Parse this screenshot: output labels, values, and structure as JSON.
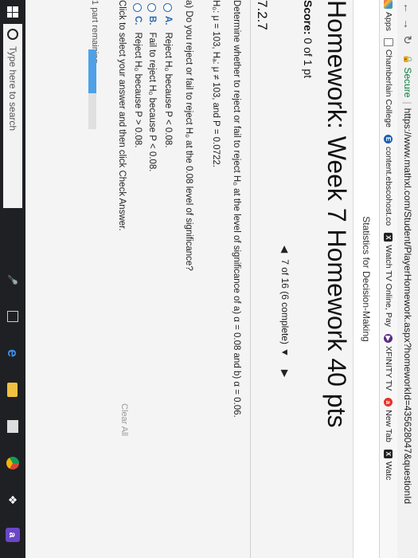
{
  "browser": {
    "secure_label": "Secure",
    "url": "https://www.mathxl.com/Student/PlayerHomework.aspx?homeworkId=435628047&questionId"
  },
  "bookmarks": [
    {
      "label": "Apps",
      "icon": "apps-icon"
    },
    {
      "label": "Chamberlain College",
      "icon": "document-icon"
    },
    {
      "label": "content.ebscohost.co",
      "icon": "ebsco-icon"
    },
    {
      "label": "Watch TV Online, Pay",
      "icon": "x-icon"
    },
    {
      "label": "XFINITY TV",
      "icon": "play-icon"
    },
    {
      "label": "New Tab",
      "icon": "a-icon"
    },
    {
      "label": "Watc",
      "icon": "x-icon"
    }
  ],
  "course_title": "Statistics for Decision-Making",
  "homework_title": "Homework: Week 7 Homework 40 pts",
  "score": {
    "label": "Score:",
    "value": "0 of 1 pt"
  },
  "progress": {
    "text": "7 of 16 (6 complete)"
  },
  "question": {
    "number": "7.2.7",
    "prompt": "Determine whether to reject or fail to reject H₀ at the level of significance of a) α = 0.08 and b) α = 0.06.",
    "hypotheses": "H₀: μ = 103, Hₐ: μ ≠ 103, and P = 0.0722.",
    "part_a": "a) Do you reject or fail to reject H₀ at the 0.08 level of significance?",
    "options": [
      {
        "letter": "A.",
        "text": "Reject H₀ because P < 0.08."
      },
      {
        "letter": "B.",
        "text": "Fail to reject H₀ because P < 0.08."
      },
      {
        "letter": "C.",
        "text": "Reject H₀ because P > 0.08."
      }
    ],
    "instruction": "Click to select your answer and then click Check Answer.",
    "clear_all": "Clear All"
  },
  "remaining": {
    "count": "1",
    "label": "part remaining",
    "fraction": 0.55
  },
  "taskbar": {
    "search_placeholder": "Type here to search"
  }
}
